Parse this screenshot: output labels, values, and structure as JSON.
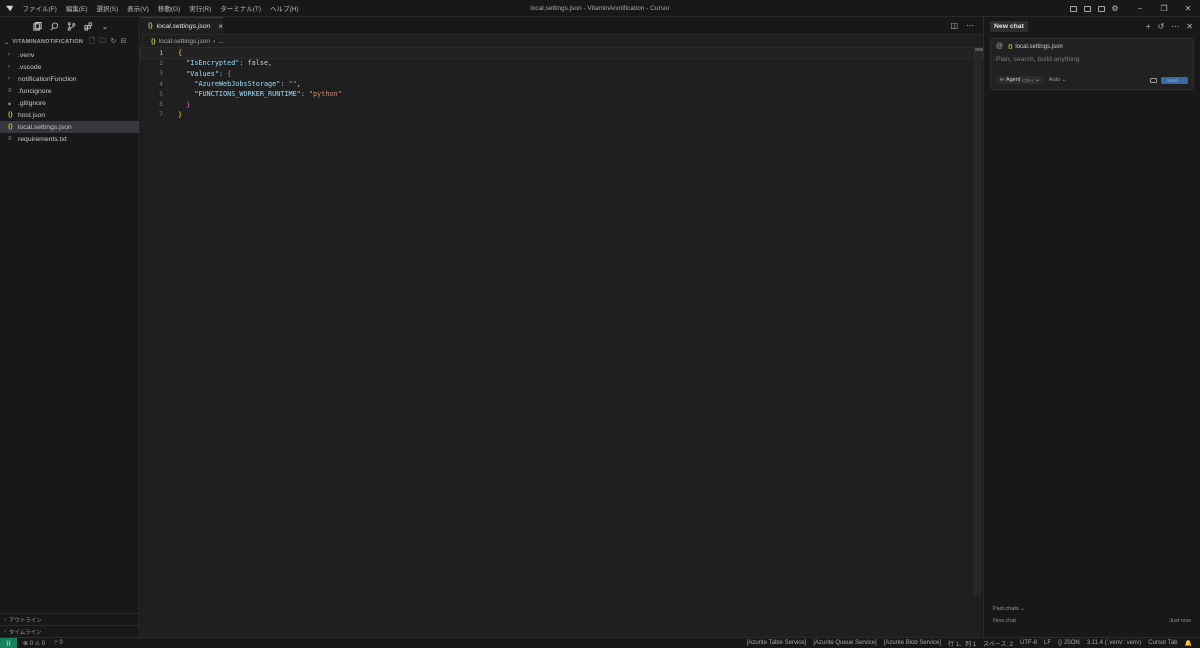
{
  "window": {
    "title": "local.settings.json - VitaminAnotification - Cursor",
    "menu": [
      "ファイル(F)",
      "編集(E)",
      "選択(S)",
      "表示(V)",
      "移動(G)",
      "実行(R)",
      "ターミナル(T)",
      "ヘルプ(H)"
    ]
  },
  "explorer": {
    "header": "VITAMINANOTIFICATION",
    "items": [
      {
        "label": ".venv",
        "icon": "chevron-right-icon",
        "glyph": "›"
      },
      {
        "label": ".vscode",
        "icon": "chevron-right-icon",
        "glyph": "›"
      },
      {
        "label": "notificationFunction",
        "icon": "chevron-right-icon",
        "glyph": "›"
      },
      {
        "label": ".funcignore",
        "icon": "lines-icon",
        "glyph": "≡"
      },
      {
        "label": ".gitignore",
        "icon": "git-icon",
        "glyph": "◆"
      },
      {
        "label": "host.json",
        "icon": "json-icon",
        "glyph": "{}"
      },
      {
        "label": "local.settings.json",
        "icon": "json-icon",
        "glyph": "{}"
      },
      {
        "label": "requirements.txt",
        "icon": "lines-icon",
        "glyph": "≡"
      }
    ],
    "outline_label": "アウトライン",
    "timeline_label": "タイムライン"
  },
  "editor": {
    "tab_label": "local.settings.json",
    "breadcrumb_file": "local.settings.json",
    "breadcrumb_sep": "›",
    "breadcrumb_more": "...",
    "line_numbers": [
      "1",
      "2",
      "3",
      "4",
      "5",
      "6",
      "7"
    ],
    "code": {
      "l1_open": "{",
      "l2_key": "\"IsEncrypted\"",
      "l2_rest": ": false,",
      "l3_key": "\"Values\"",
      "l3_colon": ": ",
      "l3_open": "{",
      "l4_key": "\"AzureWebJobsStorage\"",
      "l4_colon": ": ",
      "l4_val": "\"\"",
      "l4_comma": ",",
      "l5_key": "\"FUNCTIONS_WORKER_RUNTIME\"",
      "l5_colon": ": ",
      "l5_val": "\"python\"",
      "l6_close": "}",
      "l7_close": "}"
    }
  },
  "chat": {
    "tab_label": "New chat",
    "context_at": "@",
    "context_file": "local.settings.json",
    "placeholder": "Plan, search, build anything",
    "agent_label": "Agent",
    "agent_shortcut": "Ctrl+I",
    "model_label": "Auto",
    "send_label": "Send",
    "past_chats_label": "Past chats",
    "past_items": [
      {
        "title": "New chat",
        "time": "Just now"
      }
    ]
  },
  "status": {
    "errors": "0",
    "warnings": "0",
    "ports": "0",
    "items": [
      "[Azurite Table Service]",
      "[Azurite Queue Service]",
      "[Azurite Blob Service]",
      "行 1、列 1",
      "スペース: 2",
      "UTF-8",
      "LF",
      "{} JSON",
      "3.11.4 ('.venv': venv)",
      "Cursor Tab"
    ]
  }
}
